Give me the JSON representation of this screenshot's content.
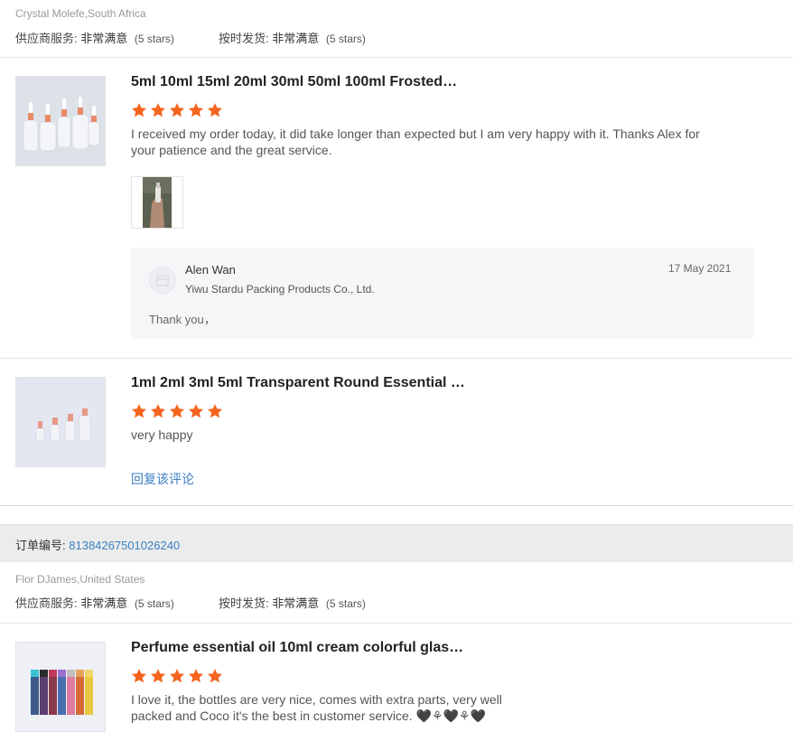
{
  "review_group_1": {
    "buyer": "Crystal Molefe,South Africa",
    "supplier_service_label": "供应商服务:",
    "supplier_service_value": "非常满意",
    "supplier_service_stars": "(5 stars)",
    "ontime_label": "按时发货:",
    "ontime_value": "非常满意",
    "ontime_stars": "(5 stars)"
  },
  "item_1": {
    "title": "5ml 10ml 15ml 20ml 30ml 50ml 100ml Frosted…",
    "rating": 5,
    "comment": "I received my order today, it did take longer than expected but I am very happy with it. Thanks Alex for your patience and the great service.",
    "reply": {
      "name": "Alen Wan",
      "company": "Yiwu Stardu Packing Products Co., Ltd.",
      "date": "17 May 2021",
      "text": "Thank you，"
    }
  },
  "item_2": {
    "title": "1ml 2ml 3ml 5ml Transparent Round Essential …",
    "rating": 5,
    "comment": "very happy",
    "reply_link": "回复该评论"
  },
  "order": {
    "label": "订单编号:",
    "number": "81384267501026240"
  },
  "review_group_2": {
    "buyer": "Flor DJames,United States",
    "supplier_service_label": "供应商服务:",
    "supplier_service_value": "非常满意",
    "supplier_service_stars": "(5 stars)",
    "ontime_label": "按时发货:",
    "ontime_value": "非常满意",
    "ontime_stars": "(5 stars)"
  },
  "item_3": {
    "title": "Perfume essential oil 10ml cream colorful glas…",
    "rating": 5,
    "comment_line1": "I love it, the bottles are very nice, comes with extra parts, very well",
    "comment_line2": "packed and Coco it's the best in customer service. 🖤⚘🖤⚘🖤"
  },
  "colors": {
    "star": "#f5641e",
    "link": "#3a7fc1",
    "divider": "#e6e6e6",
    "reply_bg": "#f5f6f8",
    "order_bar_bg": "#ececec"
  }
}
